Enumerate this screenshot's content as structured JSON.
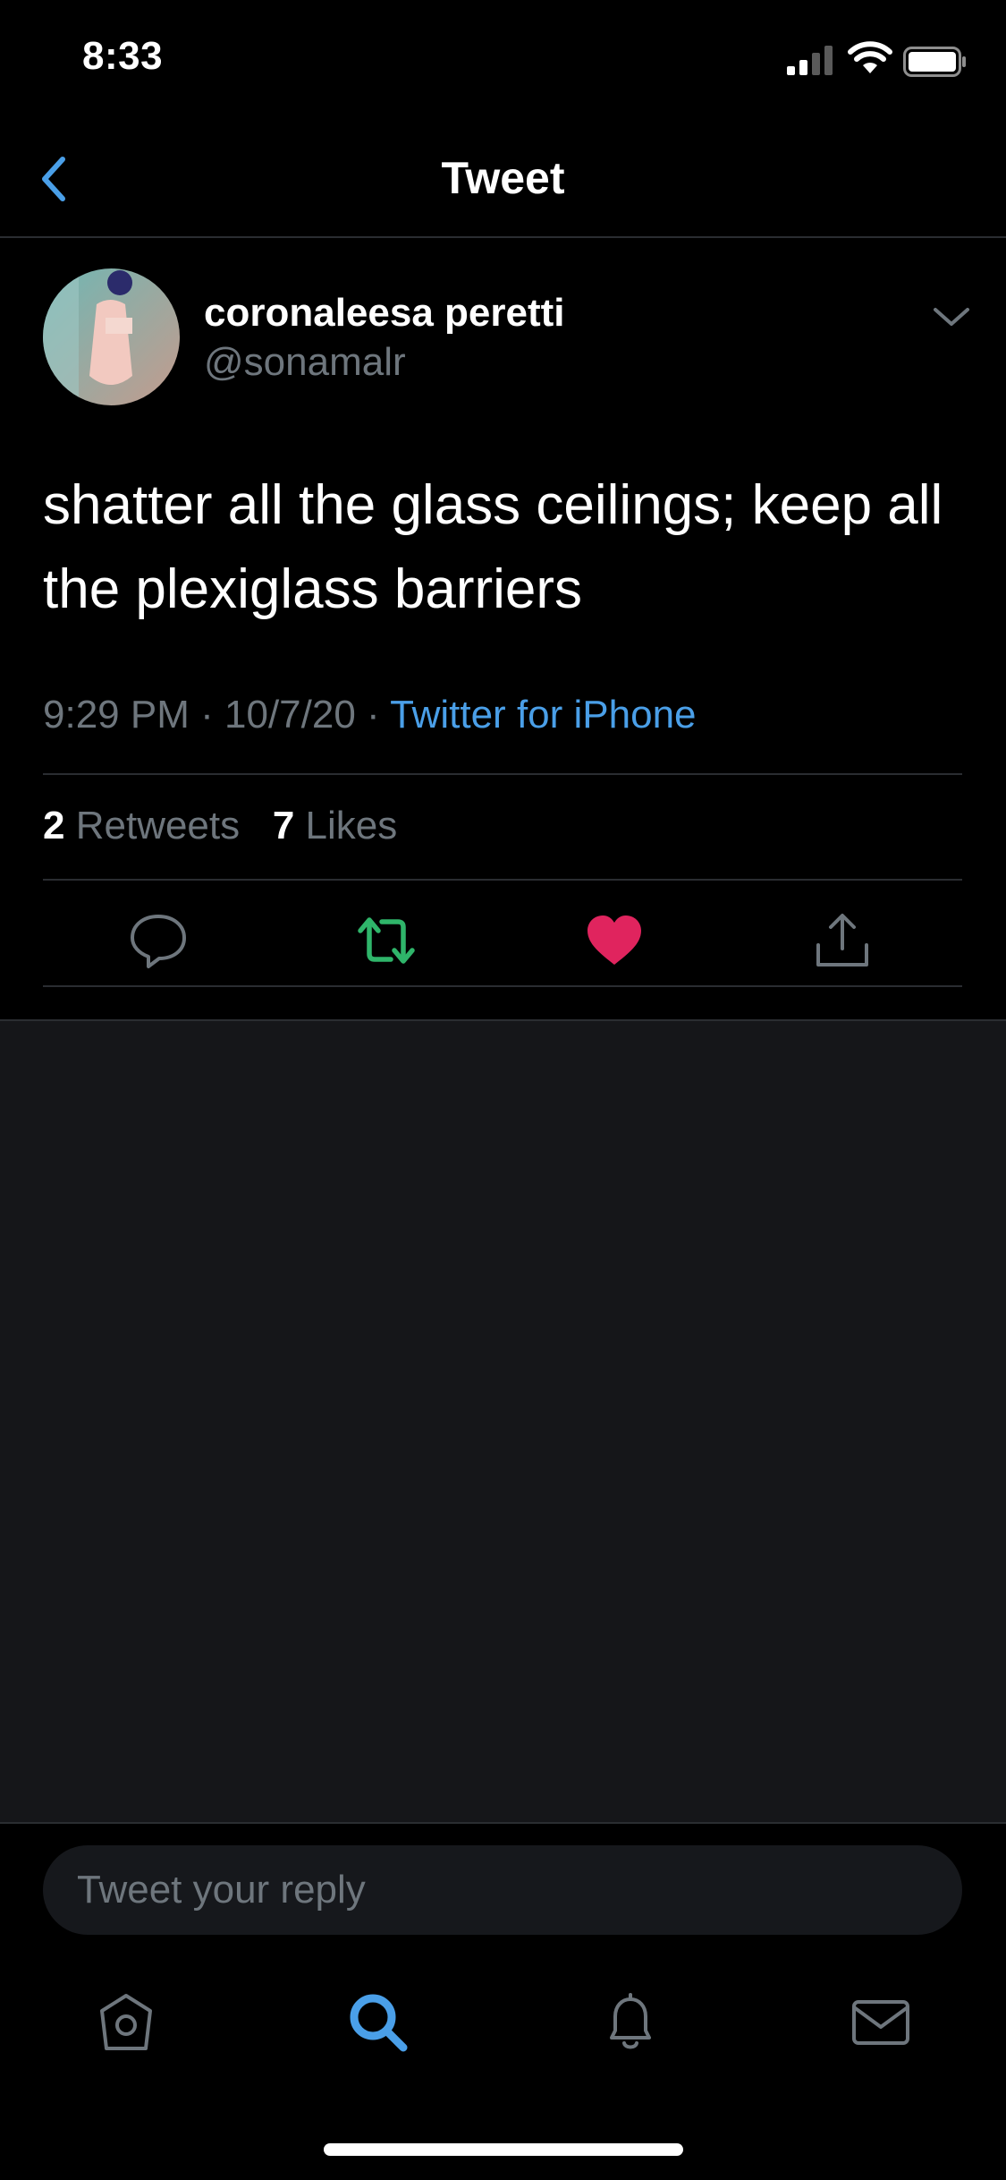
{
  "status_bar": {
    "time": "8:33"
  },
  "nav": {
    "title": "Tweet",
    "back_icon": "chevron-left-icon"
  },
  "tweet": {
    "display_name": "coronaleesa peretti",
    "handle": "@sonamalr",
    "text": "shatter all the glass ceilings; keep all the plexiglass barriers",
    "time": "9:29 PM",
    "date": "10/7/20",
    "source": "Twitter for iPhone",
    "retweets_count": "2",
    "retweets_label": "Retweets",
    "likes_count": "7",
    "likes_label": "Likes",
    "liked": true,
    "retweeted": true
  },
  "actions": [
    "reply-icon",
    "retweet-icon",
    "like-icon",
    "share-icon"
  ],
  "reply": {
    "placeholder": "Tweet your reply"
  },
  "tab_bar": [
    "home-icon",
    "search-icon",
    "notifications-icon",
    "messages-icon"
  ],
  "colors": {
    "accent": "#4a9fe8",
    "retweet": "#2fb56a",
    "like": "#e0245e",
    "muted": "#6e767d",
    "background": "#000000",
    "empty_area": "#151619"
  }
}
